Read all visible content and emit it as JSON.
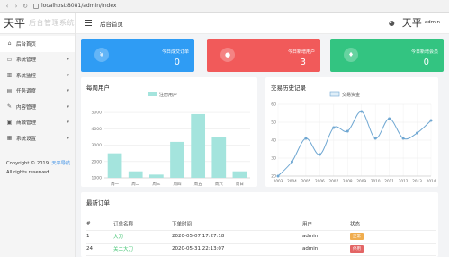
{
  "browser": {
    "url": "localhost:8081/admin/index"
  },
  "brand": {
    "logo": "天平",
    "name": "后台管理系统"
  },
  "sidebar": {
    "items": [
      {
        "label": "后台首页",
        "icon": "home-icon",
        "glyph": "⌂",
        "expandable": false,
        "active": true
      },
      {
        "label": "系统管理",
        "icon": "monitor-icon",
        "glyph": "▭",
        "expandable": true
      },
      {
        "label": "系统监控",
        "icon": "chart-icon",
        "glyph": "▥",
        "expandable": true
      },
      {
        "label": "任务调度",
        "icon": "calendar-icon",
        "glyph": "▤",
        "expandable": true
      },
      {
        "label": "内容管理",
        "icon": "edit-icon",
        "glyph": "✎",
        "expandable": true
      },
      {
        "label": "商城管理",
        "icon": "box-icon",
        "glyph": "▣",
        "expandable": true
      },
      {
        "label": "系统设置",
        "icon": "settings-icon",
        "glyph": "▦",
        "expandable": true
      }
    ],
    "copyright_prefix": "Copyright © 2019.",
    "copyright_link": "天平导航",
    "copyright_suffix": "All rights reserved."
  },
  "header": {
    "title": "后台首页",
    "avatar": "天平",
    "username": "admin",
    "palette_icon": "palette-icon"
  },
  "stats": [
    {
      "label": "今日成交订单",
      "value": "0",
      "color": "#2f9cf4",
      "icon": "yen-icon",
      "glyph": "¥"
    },
    {
      "label": "今日新增用户",
      "value": "3",
      "color": "#f15a5a",
      "icon": "user-icon",
      "glyph": "●"
    },
    {
      "label": "今日新增会员",
      "value": "0",
      "color": "#33c481",
      "icon": "member-icon",
      "glyph": "♦"
    }
  ],
  "weekly_users": {
    "title": "每周用户",
    "chart_data": {
      "type": "bar",
      "legend": "注册用户",
      "categories": [
        "周一",
        "周二",
        "周三",
        "周四",
        "周五",
        "周六",
        "周日"
      ],
      "values": [
        2500,
        1400,
        1200,
        3200,
        4900,
        3500,
        1400
      ],
      "yticks": [
        1000,
        2000,
        3000,
        4000,
        5000
      ],
      "ylim": [
        1000,
        5500
      ],
      "color": "#a4e4dd"
    }
  },
  "trade_history": {
    "title": "交易历史记录",
    "chart_data": {
      "type": "line",
      "legend": "交易资金",
      "categories": [
        "2003",
        "2004",
        "2005",
        "2006",
        "2007",
        "2008",
        "2009",
        "2010",
        "2011",
        "2012",
        "2013",
        "2014"
      ],
      "values": [
        20,
        28,
        41,
        32,
        47,
        45,
        56,
        41,
        52,
        41,
        44,
        51
      ],
      "yticks": [
        20,
        30,
        40,
        50,
        60
      ],
      "ylim": [
        20,
        60
      ],
      "color": "#6fa7d2"
    }
  },
  "orders": {
    "title": "最新订单",
    "columns": [
      "#",
      "订单名称",
      "下单时间",
      "用户",
      "状态"
    ],
    "rows": [
      {
        "id": "1",
        "name": "大刀",
        "time": "2020-05-07 17:27:18",
        "user": "admin",
        "status": "正常",
        "status_color": "#f0ad4e"
      },
      {
        "id": "24",
        "name": "关二大刀",
        "time": "2020-05-31 22:13:07",
        "user": "admin",
        "status": "停用",
        "status_color": "#e36565"
      }
    ]
  }
}
